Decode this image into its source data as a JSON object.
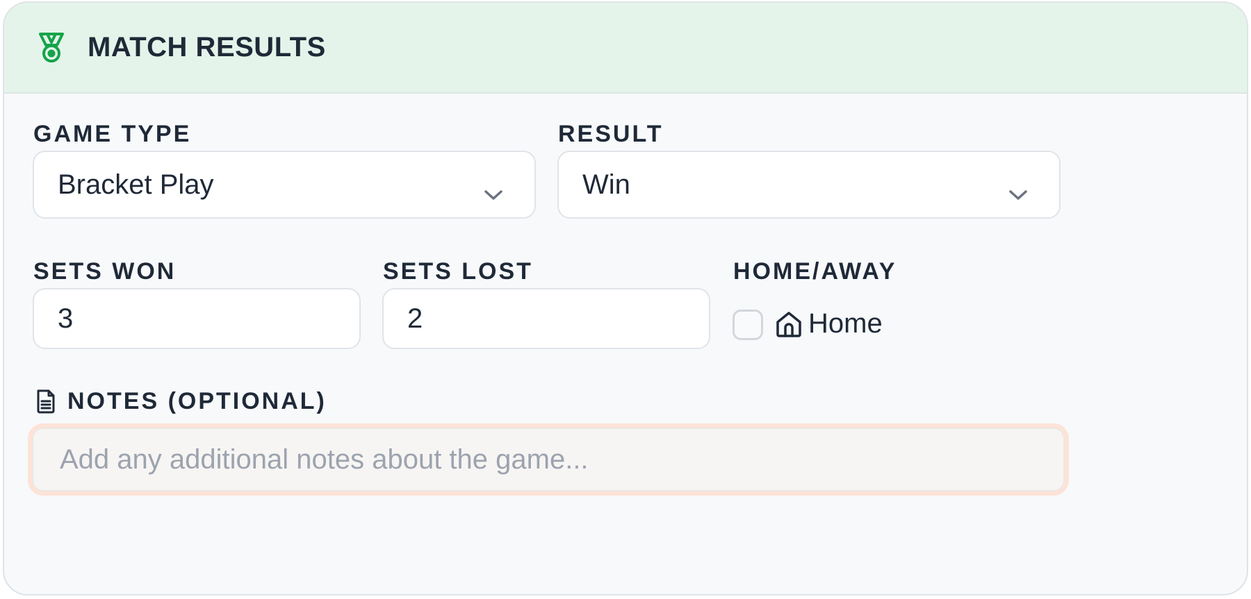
{
  "header": {
    "title": "MATCH RESULTS",
    "icon": "medal-icon",
    "accent": "#16a34a",
    "background": "#e4f4ea"
  },
  "fields": {
    "game_type": {
      "label": "GAME TYPE",
      "value": "Bracket Play"
    },
    "result": {
      "label": "RESULT",
      "value": "Win"
    },
    "sets_won": {
      "label": "SETS WON",
      "value": "3"
    },
    "sets_lost": {
      "label": "SETS LOST",
      "value": "2"
    },
    "home_away": {
      "label": "HOME/AWAY",
      "option_label": "Home",
      "checked": false,
      "icon": "home-icon"
    },
    "notes": {
      "label": "NOTES (OPTIONAL)",
      "placeholder": "Add any additional notes about the game...",
      "icon": "document-icon"
    }
  }
}
